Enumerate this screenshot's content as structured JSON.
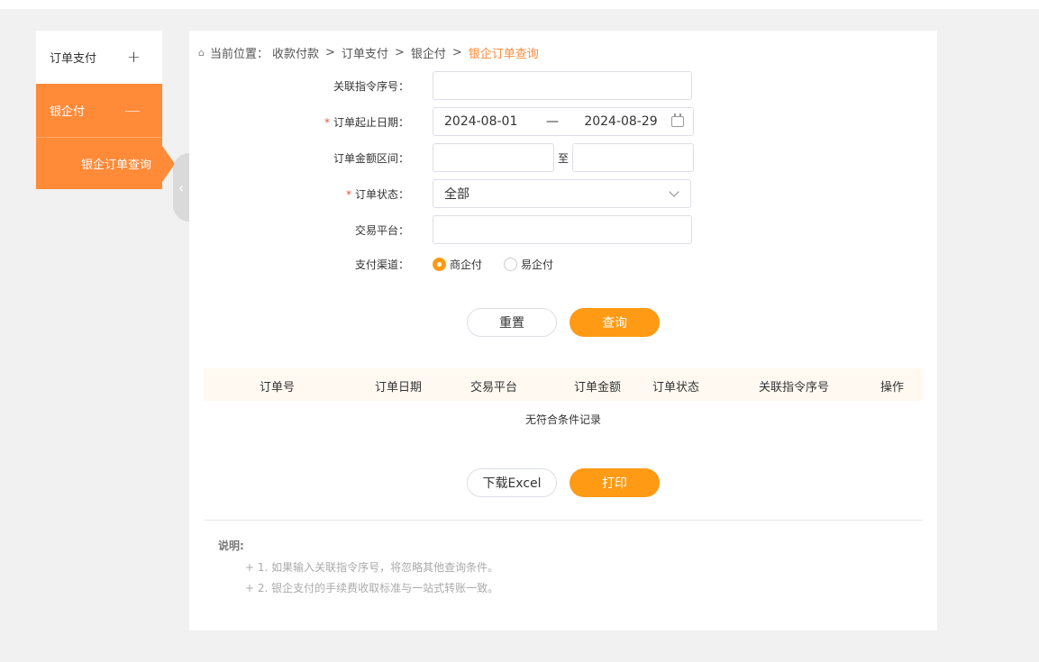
{
  "sidebar": {
    "items": [
      {
        "label": "订单支付",
        "sign": "+"
      },
      {
        "label": "银企付",
        "sign": "—"
      }
    ],
    "sub_item": "银企订单查询"
  },
  "collapse_glyph": "‹",
  "breadcrumb": {
    "prefix": "当前位置：",
    "parts": [
      "收款付款",
      "订单支付",
      "银企付"
    ],
    "current": "银企订单查询",
    "sep": ">"
  },
  "form": {
    "ref_label": "关联指令序号：",
    "date_label": "订单起止日期：",
    "date_start": "2024-08-01",
    "date_dash": "—",
    "date_end": "2024-08-29",
    "amount_label": "订单金额区间：",
    "amount_to": "至",
    "status_label": "订单状态：",
    "status_value": "全部",
    "platform_label": "交易平台：",
    "channel_label": "支付渠道：",
    "channel_options": [
      "商企付",
      "易企付"
    ],
    "required_mark": "*"
  },
  "buttons": {
    "reset": "重置",
    "query": "查询",
    "download": "下载Excel",
    "print": "打印"
  },
  "table": {
    "headers": [
      "订单号",
      "订单日期",
      "交易平台",
      "订单金额",
      "订单状态",
      "关联指令序号",
      "操作"
    ],
    "empty": "无符合条件记录"
  },
  "notes": {
    "title": "说明:",
    "items": [
      "+ 1. 如果输入关联指令序号，将忽略其他查询条件。",
      "+ 2. 银企支付的手续费收取标准与一站式转账一致。"
    ]
  },
  "colors": {
    "accent": "#ff8a38",
    "button": "#ff9a14"
  }
}
